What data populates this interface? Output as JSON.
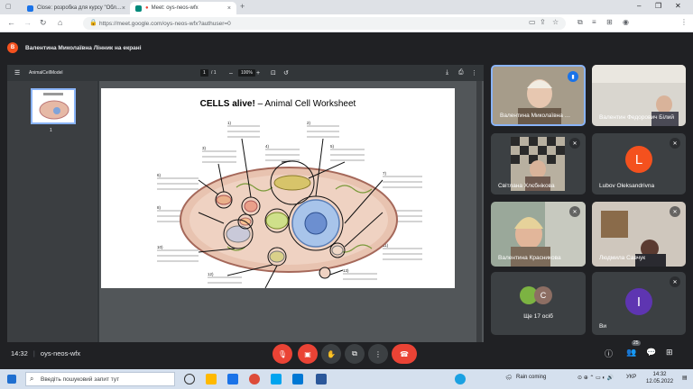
{
  "browser": {
    "tabs": [
      {
        "label": "Close: розробка для курсу \"Обл…",
        "active": false
      },
      {
        "label": "Meet: oys-neos-wfx",
        "active": true
      }
    ],
    "url": "https://meet.google.com/oys-neos-wfx?authuser=0"
  },
  "meet": {
    "presenter_label": "Валентина Миколаївна Лінник на екрані",
    "presenter_initial": "В",
    "meeting_code": "oys-neos-wfx",
    "clock": "14:32",
    "participants_badge": "25",
    "more_people_label": "Ще 17 осіб",
    "self_label": "Ви",
    "self_initial": "I",
    "tiles": [
      {
        "name": "Валентина Миколаївна …"
      },
      {
        "name": "Валентин Федорович Білий"
      },
      {
        "name": "Світлана Хлєбнікова"
      },
      {
        "name": "Lubov Oleksandrivna",
        "initial": "L"
      },
      {
        "name": "Валентина Красникова"
      },
      {
        "name": "Людмила Савчук"
      }
    ],
    "more_initial": "C"
  },
  "pdf": {
    "filename": "AnimalCellModel",
    "page_current": "1",
    "page_total": "/ 1",
    "zoom": "100%",
    "thumb_page": "1",
    "worksheet_title_bold": "CELLS alive!",
    "worksheet_title_rest": " – Animal Cell Worksheet",
    "label_numbers": [
      "1)",
      "2)",
      "3)",
      "4)",
      "5)",
      "6)",
      "7)",
      "8)",
      "9)",
      "10)",
      "11)",
      "12)",
      "13)"
    ]
  },
  "taskbar": {
    "search_placeholder": "Введіть пошуковий запит тут",
    "weather": "Rain coming",
    "language": "УКР",
    "time": "14:32",
    "date": "12.05.2022"
  },
  "colors": {
    "meet_bg": "#202124",
    "end_call": "#ea4335",
    "accent_blue": "#8ab4f8",
    "avatar_orange": "#f4511e",
    "avatar_purple": "#5e35b1"
  }
}
